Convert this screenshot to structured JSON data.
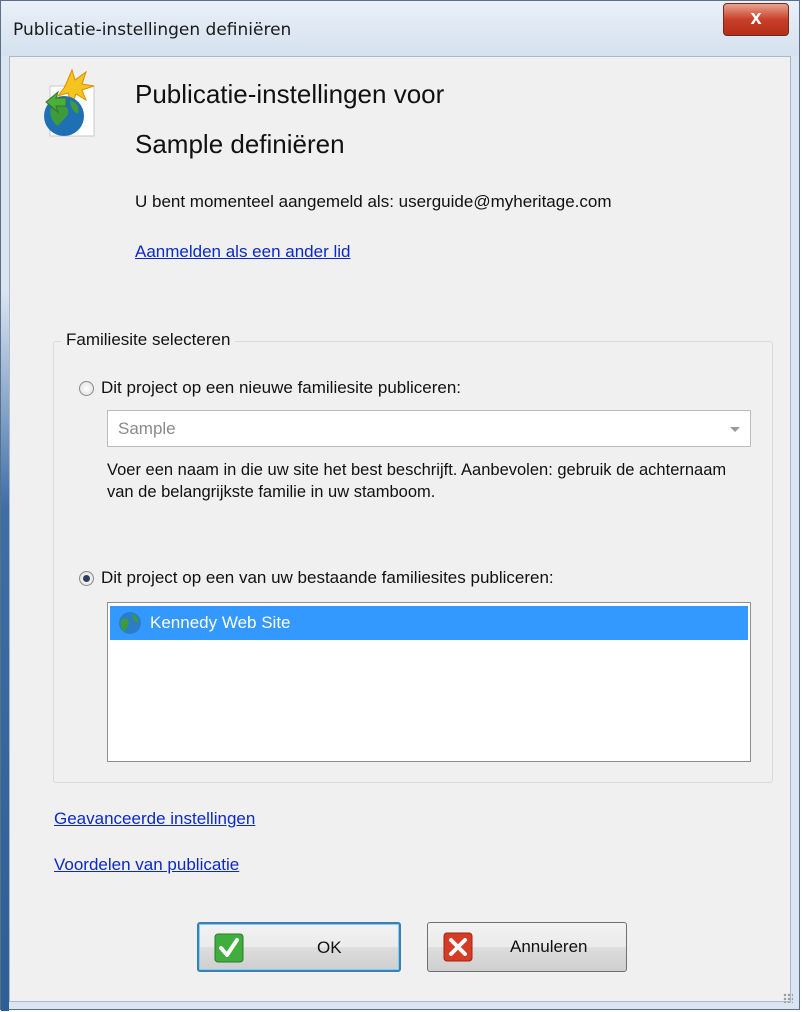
{
  "window": {
    "title": "Publicatie-instellingen definiëren",
    "close_label": "x"
  },
  "header": {
    "title_line1": "Publicatie-instellingen voor",
    "title_line2": "Sample definiëren",
    "icon": "publish-globe-icon"
  },
  "account": {
    "logged_in_text": "U bent momenteel aangemeld als: userguide@myheritage.com",
    "switch_link": "Aanmelden als een ander lid"
  },
  "site_selection": {
    "group_label": "Familiesite selecteren",
    "new_site_option": {
      "label": "Dit project op een nieuwe familiesite publiceren:",
      "checked": false,
      "combo_value": "Sample",
      "hint": "Voer een naam in die uw site het best beschrijft. Aanbevolen: gebruik de achternaam van de belangrijkste familie in uw stamboom."
    },
    "existing_site_option": {
      "label": "Dit project op een van uw bestaande familiesites publiceren:",
      "checked": true,
      "sites": [
        {
          "name": "Kennedy Web Site",
          "selected": true,
          "icon": "globe-icon"
        }
      ]
    }
  },
  "links": {
    "advanced": "Geavanceerde instellingen",
    "benefits": "Voordelen van publicatie"
  },
  "buttons": {
    "ok": "OK",
    "cancel": "Annuleren"
  },
  "colors": {
    "selection": "#3399ff",
    "link": "#0b29c7",
    "ok_icon": "#3fae3f",
    "cancel_icon": "#d63b25"
  }
}
